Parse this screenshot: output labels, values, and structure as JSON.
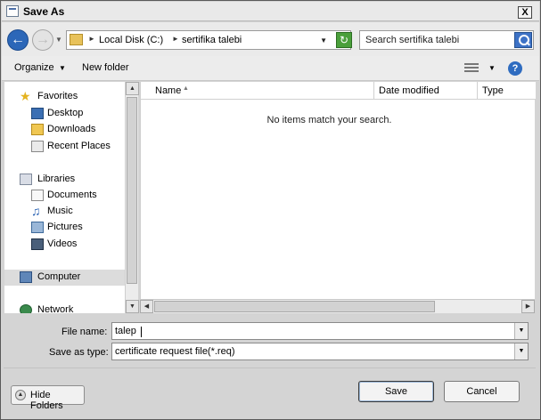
{
  "window": {
    "title": "Save As",
    "close_label": "X"
  },
  "address": {
    "crumbs": [
      "Local Disk (C:)",
      "sertifika talebi"
    ],
    "search_placeholder": "Search sertifika talebi"
  },
  "toolbar": {
    "organize_label": "Organize",
    "new_folder_label": "New folder",
    "help_label": "?"
  },
  "nav": {
    "favorites": {
      "label": "Favorites",
      "items": [
        "Desktop",
        "Downloads",
        "Recent Places"
      ]
    },
    "libraries": {
      "label": "Libraries",
      "items": [
        "Documents",
        "Music",
        "Pictures",
        "Videos"
      ]
    },
    "computer_label": "Computer",
    "network_label": "Network"
  },
  "files": {
    "columns": [
      "Name",
      "Date modified",
      "Type"
    ],
    "empty_message": "No items match your search."
  },
  "form": {
    "file_name_label": "File name:",
    "file_name_value": "talep",
    "save_type_label": "Save as type:",
    "save_type_value": "certificate request file(*.req)"
  },
  "footer": {
    "hide_folders_label": "Hide Folders",
    "save_label": "Save",
    "cancel_label": "Cancel"
  }
}
